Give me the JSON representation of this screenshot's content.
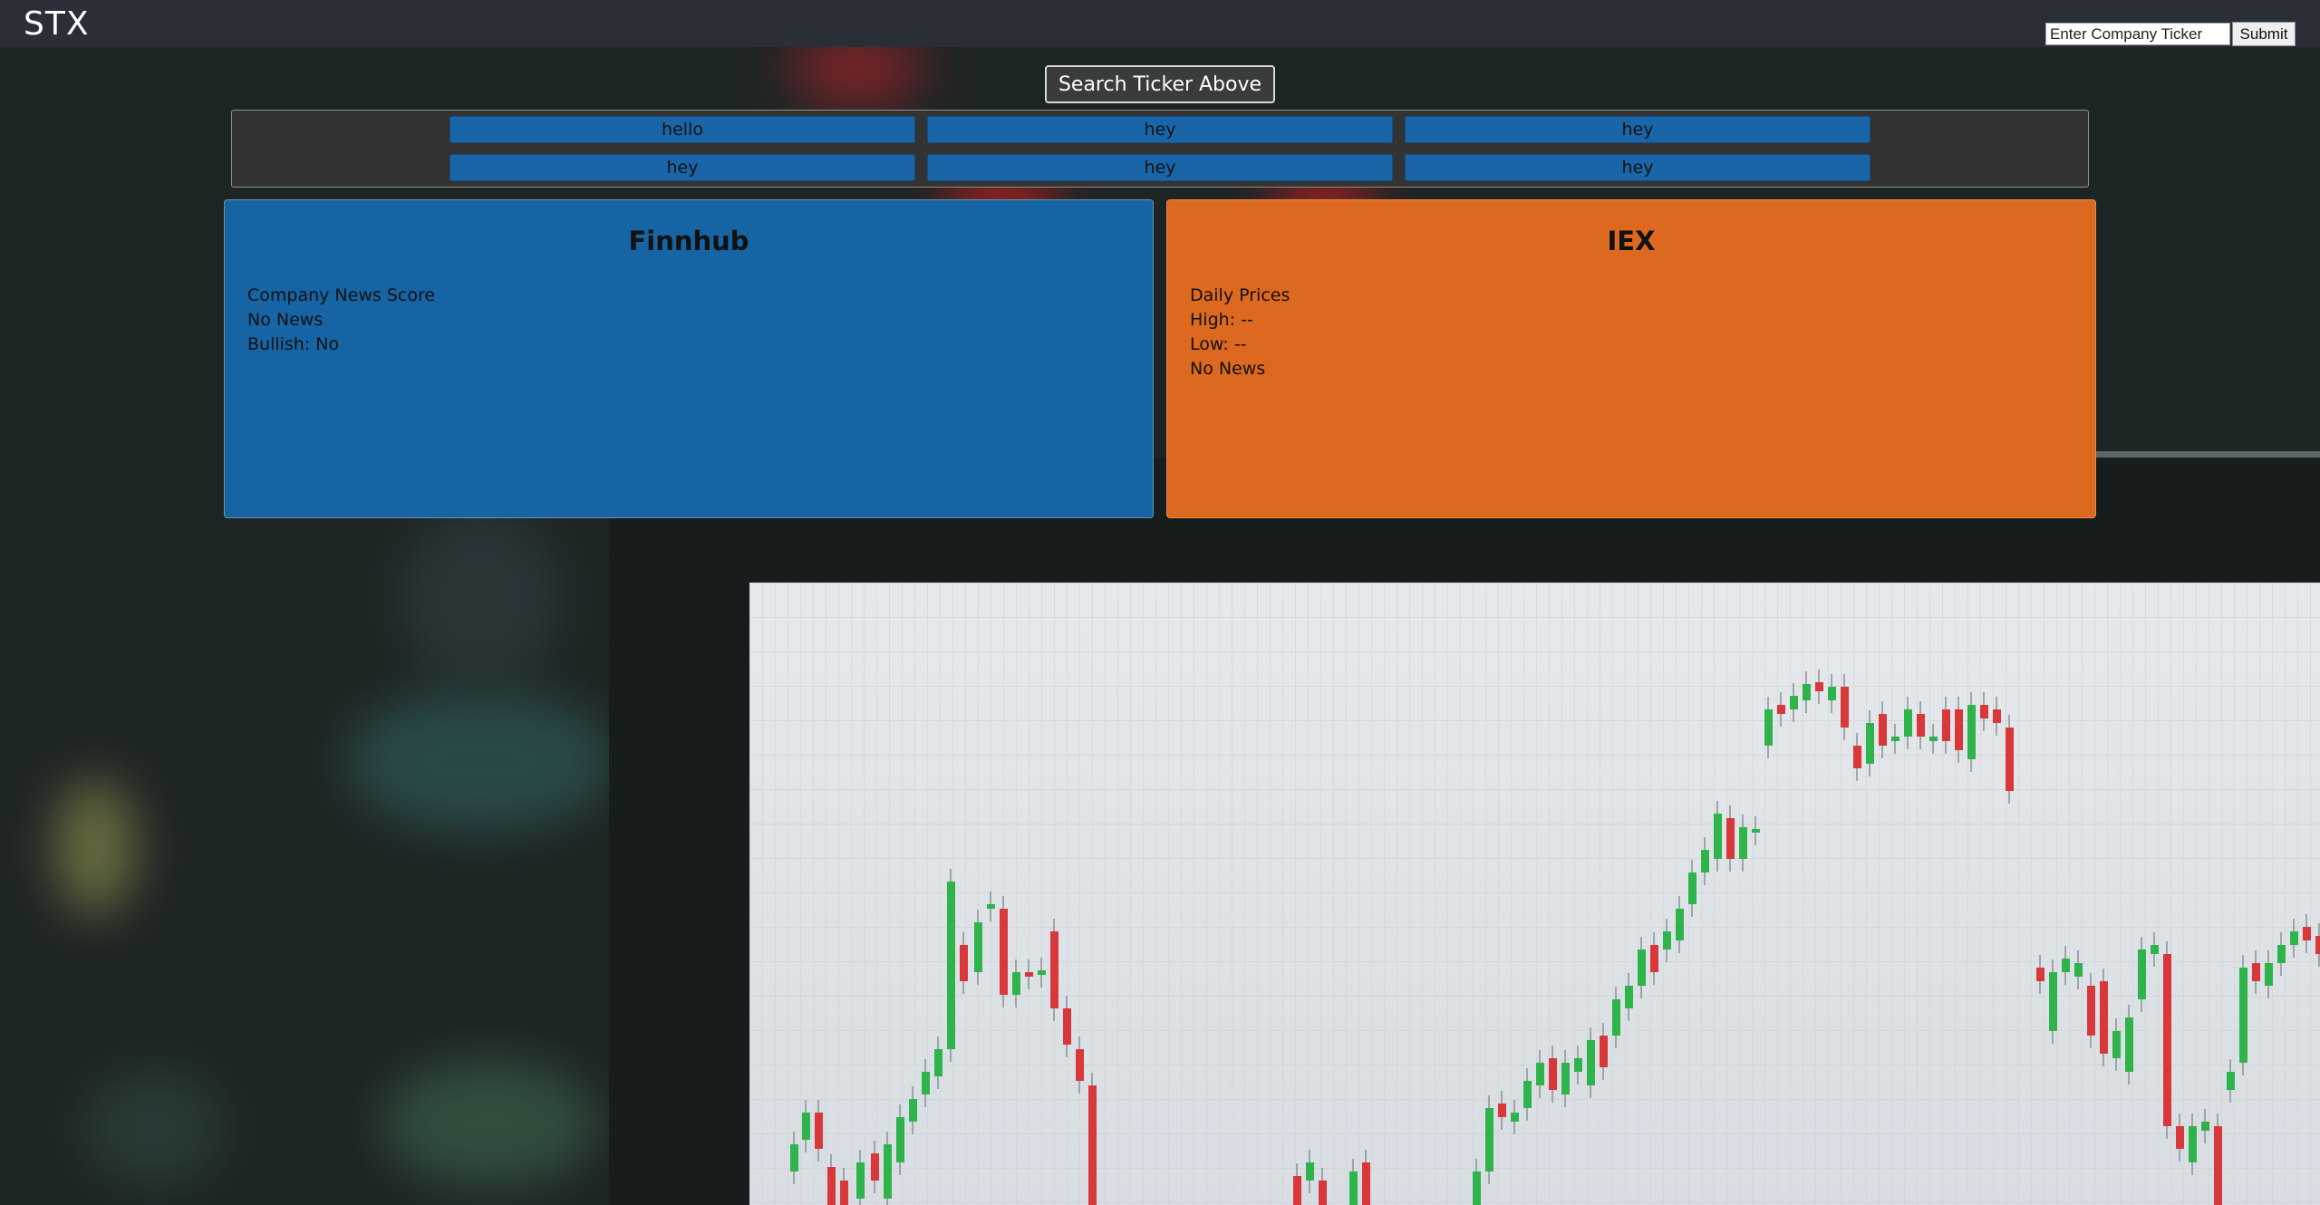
{
  "header": {
    "brand": "STX",
    "ticker_input_placeholder": "Enter Company Ticker",
    "ticker_input_value": "",
    "submit_label": "Submit"
  },
  "search_button_label": "Search Ticker Above",
  "grid_buttons": [
    "hello",
    "hey",
    "hey",
    "hey",
    "hey",
    "hey"
  ],
  "finnhub": {
    "title": "Finnhub",
    "lines": [
      "Company News Score",
      "No News",
      "Bullish: No"
    ]
  },
  "iex": {
    "title": "IEX",
    "lines": [
      "Daily Prices",
      "High: --",
      "Low: --",
      "No News"
    ]
  },
  "colors": {
    "header_bg": "#2a2e36",
    "finnhub_card": "#1664a4",
    "iex_card": "#dc691f",
    "grid_button": "#1a65a8",
    "panel_bg": "#333333"
  }
}
